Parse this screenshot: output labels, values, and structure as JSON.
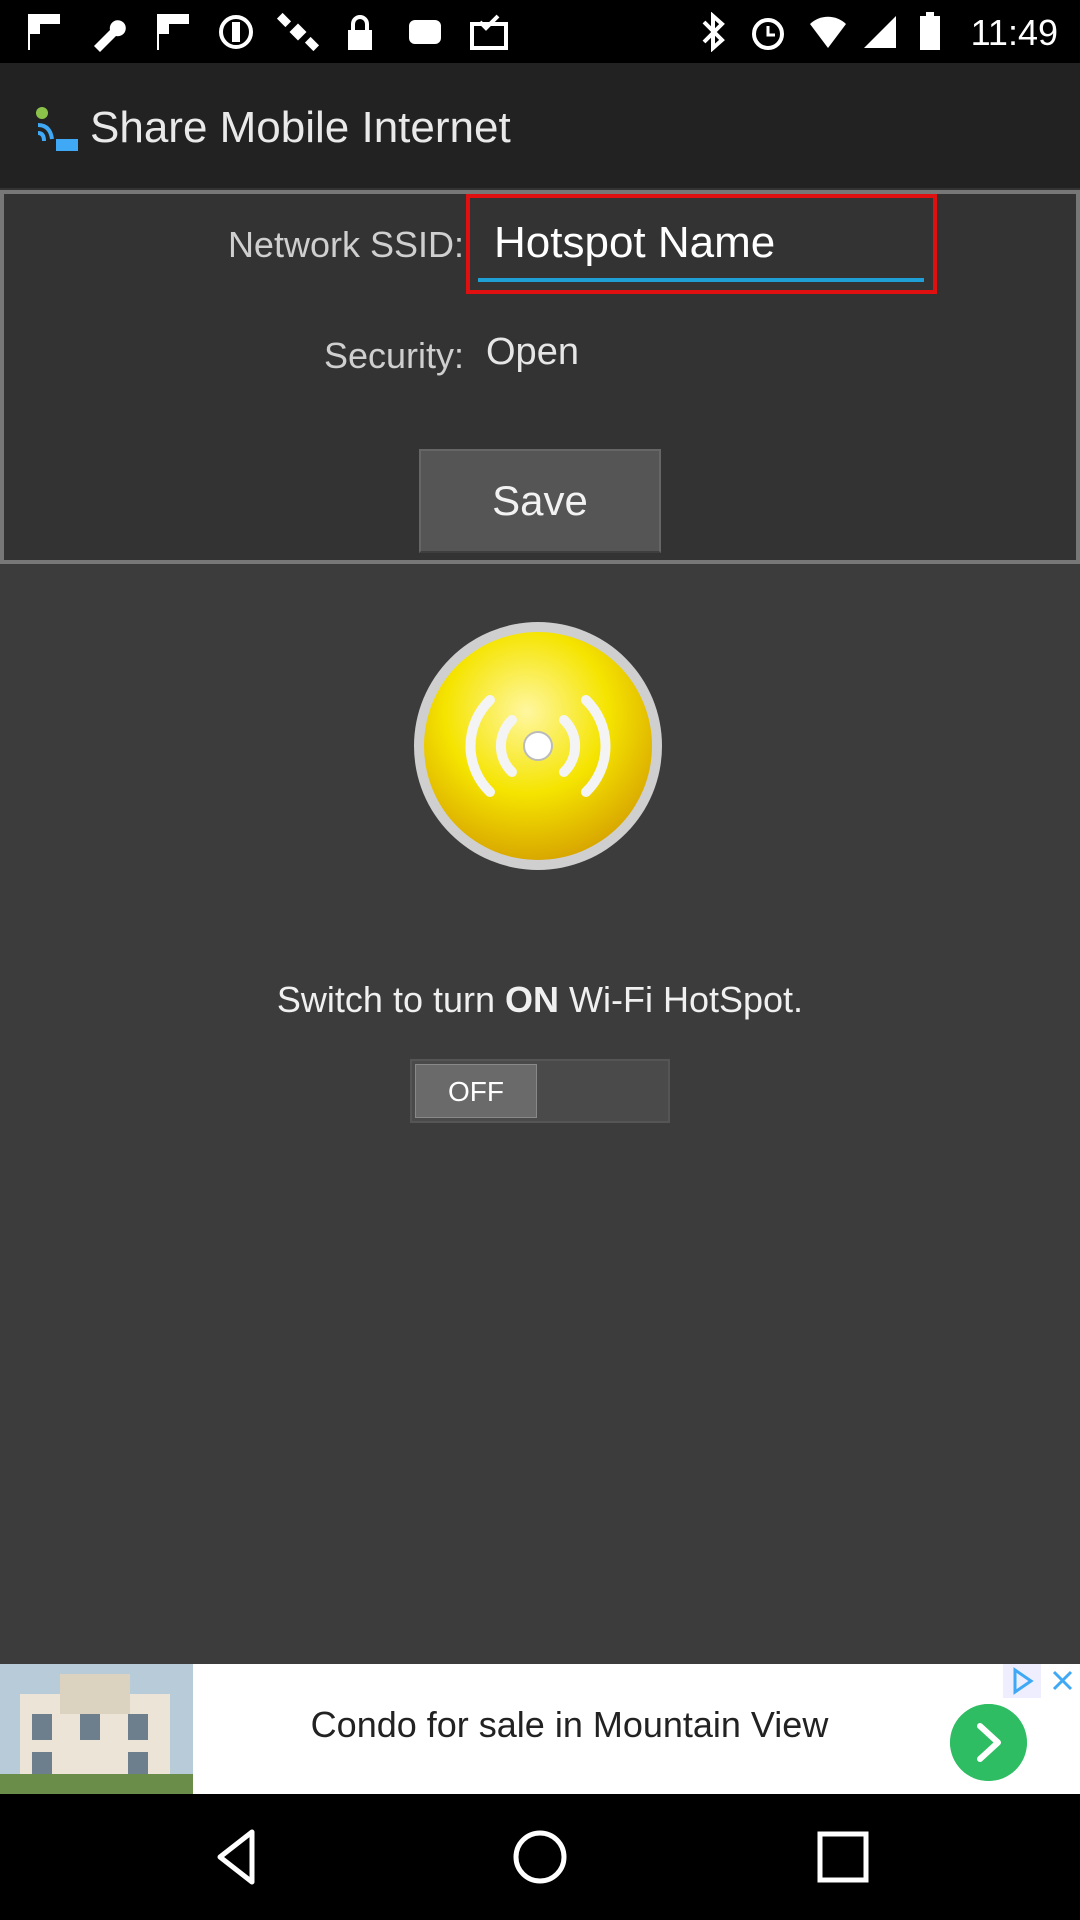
{
  "status_bar": {
    "time": "11:49"
  },
  "app_bar": {
    "title": "Share Mobile Internet"
  },
  "form": {
    "ssid_label": "Network SSID:",
    "ssid_value": "Hotspot Name",
    "security_label": "Security:",
    "security_value": "Open",
    "save_label": "Save"
  },
  "hotspot": {
    "instruction_prefix": "Switch to turn ",
    "instruction_bold": "ON",
    "instruction_suffix": " Wi-Fi HotSpot.",
    "toggle_label": "OFF",
    "toggle_on": false
  },
  "ad": {
    "text": "Condo for sale in Mountain View"
  },
  "colors": {
    "accent_blue": "#1e9fd6",
    "highlight_red": "#e01010",
    "hotspot_yellow": "#f5e400",
    "ad_green": "#2ebd63"
  },
  "icons": [
    "app-logo-icon",
    "hotspot-signal-icon",
    "back-nav-icon",
    "home-nav-icon",
    "recents-nav-icon"
  ]
}
